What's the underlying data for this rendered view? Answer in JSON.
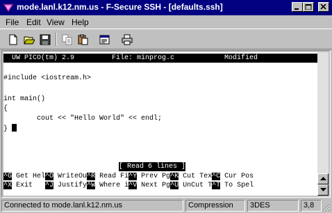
{
  "window": {
    "title": "mode.lanl.k12.nm.us - F-Secure SSH - [defaults.ssh]"
  },
  "menu": {
    "items": [
      "File",
      "Edit",
      "View",
      "Help"
    ]
  },
  "toolbar": {
    "buttons": [
      "new-icon",
      "open-icon",
      "save-icon",
      "copy-icon",
      "paste-icon",
      "properties-icon",
      "print-icon"
    ]
  },
  "terminal": {
    "header": "  UW PICO(tm) 2.9         File: minprog.c            Modified   ",
    "lines": [
      "",
      "#include <iostream.h>",
      "",
      "int main()",
      "{",
      "        cout << \"Hello World\" << endl;",
      "} "
    ],
    "message": "[ Read 6 lines ]",
    "shortcuts_row1": [
      {
        "key": "^G",
        "label": " Get Hel"
      },
      {
        "key": "^O",
        "label": " WriteOu"
      },
      {
        "key": "^R",
        "label": " Read Fi"
      },
      {
        "key": "^Y",
        "label": " Prev Pg"
      },
      {
        "key": "^K",
        "label": " Cut Tex"
      },
      {
        "key": "^C",
        "label": " Cur Pos"
      }
    ],
    "shortcuts_row2": [
      {
        "key": "^X",
        "label": " Exit   "
      },
      {
        "key": "^J",
        "label": " Justify"
      },
      {
        "key": "^W",
        "label": " Where i"
      },
      {
        "key": "^V",
        "label": " Next Pg"
      },
      {
        "key": "^U",
        "label": " UnCut T"
      },
      {
        "key": "^T",
        "label": " To Spel"
      }
    ]
  },
  "status": {
    "connection": "Connected to mode.lanl.k12.nm.us",
    "compression": "Compression",
    "cipher": "3DES",
    "position": "3,8"
  }
}
